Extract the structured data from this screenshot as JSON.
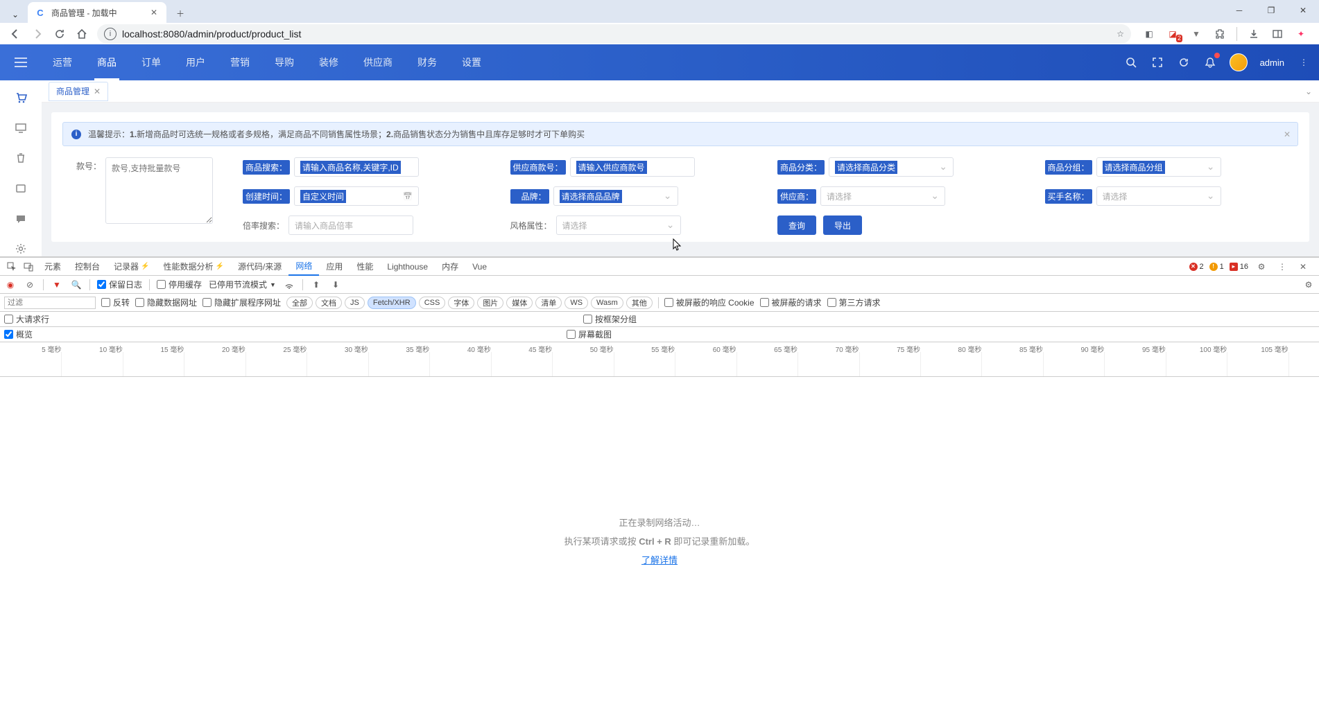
{
  "browser": {
    "tab_title": "商品管理 - 加载中",
    "url": "localhost:8080/admin/product/product_list",
    "ext_badge": "2"
  },
  "header": {
    "nav": [
      "运营",
      "商品",
      "订单",
      "用户",
      "营销",
      "导购",
      "装修",
      "供应商",
      "财务",
      "设置"
    ],
    "active_nav": 1,
    "username": "admin"
  },
  "page": {
    "tab": "商品管理",
    "alert_prefix": "温馨提示：",
    "alert_b1": "1.",
    "alert_t1": "新增商品时可选统一规格或者多规格，满足商品不同销售属性场景；",
    "alert_b2": "2.",
    "alert_t2": "商品销售状态分为销售中且库存足够时才可下单购买",
    "filters": {
      "style_no": {
        "label": "款号：",
        "placeholder": "款号,支持批量款号"
      },
      "search": {
        "label": "商品搜索：",
        "placeholder": "请输入商品名称,关键字,ID"
      },
      "supplier_no": {
        "label": "供应商款号：",
        "placeholder": "请输入供应商款号"
      },
      "category": {
        "label": "商品分类：",
        "placeholder": "请选择商品分类"
      },
      "group": {
        "label": "商品分组：",
        "placeholder": "请选择商品分组"
      },
      "create_time": {
        "label": "创建时间：",
        "placeholder": "自定义时间"
      },
      "brand": {
        "label": "品牌：",
        "placeholder": "请选择商品品牌"
      },
      "supplier": {
        "label": "供应商：",
        "placeholder": "请选择"
      },
      "buyer": {
        "label": "买手名称：",
        "placeholder": "请选择"
      },
      "multiple": {
        "label": "倍率搜索：",
        "placeholder": "请输入商品倍率"
      },
      "style_attr": {
        "label": "风格属性：",
        "placeholder": "请选择"
      }
    },
    "btn_query": "查询",
    "btn_export": "导出"
  },
  "devtools": {
    "tabs": [
      "元素",
      "控制台",
      "记录器",
      "性能数据分析",
      "源代码/来源",
      "网络",
      "应用",
      "性能",
      "Lighthouse",
      "内存",
      "Vue"
    ],
    "active_tab": 5,
    "status": {
      "errors": "2",
      "warnings": "1",
      "info": "16"
    },
    "toolbar": {
      "preserve_log": "保留日志",
      "disable_cache": "停用缓存",
      "throttling": "已停用节流模式"
    },
    "filter": {
      "placeholder": "过滤",
      "invert": "反转",
      "hide_data": "隐藏数据网址",
      "hide_ext": "隐藏扩展程序网址",
      "pills": [
        "全部",
        "文档",
        "JS",
        "Fetch/XHR",
        "CSS",
        "字体",
        "图片",
        "媒体",
        "清单",
        "WS",
        "Wasm",
        "其他"
      ],
      "active_pill": 3,
      "blocked_cookies": "被屏蔽的响应 Cookie",
      "blocked_req": "被屏蔽的请求",
      "third_party": "第三方请求"
    },
    "opts": {
      "big_rows": "大请求行",
      "group_frame": "按框架分组",
      "overview": "概览",
      "screenshot": "屏幕截图"
    },
    "waterfall_ticks": [
      "5 毫秒",
      "10 毫秒",
      "15 毫秒",
      "20 毫秒",
      "25 毫秒",
      "30 毫秒",
      "35 毫秒",
      "40 毫秒",
      "45 毫秒",
      "50 毫秒",
      "55 毫秒",
      "60 毫秒",
      "65 毫秒",
      "70 毫秒",
      "75 毫秒",
      "80 毫秒",
      "85 毫秒",
      "90 毫秒",
      "95 毫秒",
      "100 毫秒",
      "105 毫秒"
    ],
    "empty": {
      "line1": "正在录制网络活动…",
      "line2a": "执行某项请求或按 ",
      "line2b": "Ctrl + R",
      "line2c": " 即可记录重新加载。",
      "link": "了解详情"
    }
  }
}
